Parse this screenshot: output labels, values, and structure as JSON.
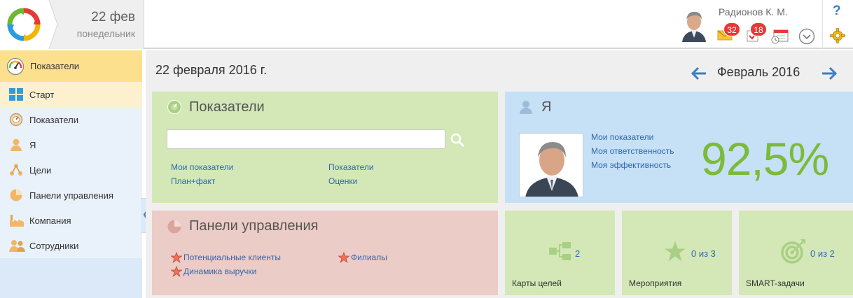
{
  "header": {
    "date_day": "22 фев",
    "date_weekday": "понедельник",
    "user_name": "Радионов К. М.",
    "mail_count": "32",
    "tasks_count": "18",
    "help_label": "?"
  },
  "sidebar": {
    "section_title": "Показатели",
    "items": [
      {
        "label": "Старт",
        "icon": "grid-icon",
        "active": true
      },
      {
        "label": "Показатели",
        "icon": "gauge-icon"
      },
      {
        "label": "Я",
        "icon": "person-icon"
      },
      {
        "label": "Цели",
        "icon": "goals-icon"
      },
      {
        "label": "Панели управления",
        "icon": "pie-icon"
      },
      {
        "label": "Компания",
        "icon": "factory-icon"
      },
      {
        "label": "Сотрудники",
        "icon": "people-icon"
      }
    ]
  },
  "main": {
    "page_title": "22 февраля 2016 г.",
    "month_label": "Февраль 2016"
  },
  "indicators_panel": {
    "title": "Показатели",
    "search_placeholder": "",
    "links": [
      "Мои показатели",
      "План+факт",
      "Показатели",
      "Оценки"
    ]
  },
  "me_panel": {
    "title": "Я",
    "links": [
      "Мои показатели",
      "Моя ответственность",
      "Моя эффективность"
    ],
    "efficiency": "92,5%"
  },
  "dashboards_panel": {
    "title": "Панели управления",
    "links": [
      "Потенциальные клиенты",
      "Динамика выручки",
      "Филиалы"
    ]
  },
  "tiles": [
    {
      "label": "Карты целей",
      "count": "2"
    },
    {
      "label": "Мероприятия",
      "count": "0 из 3"
    },
    {
      "label": "SMART-задачи",
      "count": "0 из 2"
    }
  ],
  "colors": {
    "accent_blue": "#3a7fc1",
    "green_panel": "#d3e8b6",
    "blue_panel": "#c6e0f5",
    "red_panel": "#ecccc7",
    "sidebar_header": "#fde08d",
    "badge_red": "#e53935"
  }
}
